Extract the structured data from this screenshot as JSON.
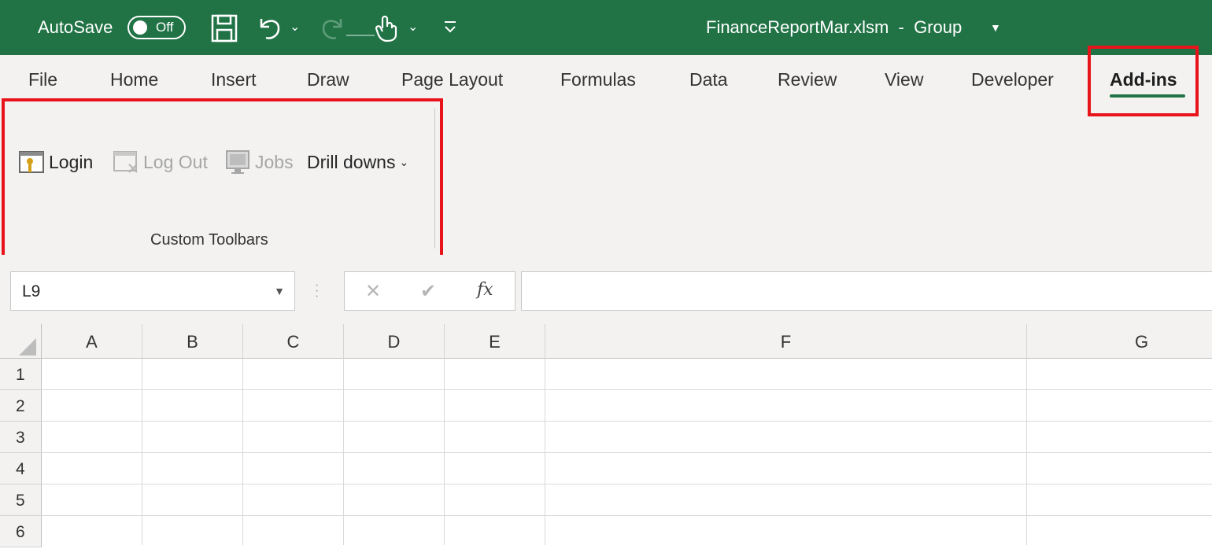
{
  "colors": {
    "titlebar": "#217346",
    "ribbon_bg": "#f3f2f1",
    "highlight": "#e8141b",
    "active_tab_underline": "#217346"
  },
  "titlebar": {
    "autosave_label": "AutoSave",
    "autosave_state": "Off",
    "document_title": "FinanceReportMar.xlsm  -  Group",
    "icons": [
      "save-icon",
      "undo-icon",
      "redo-icon",
      "touch-mode-icon",
      "customize-qat-icon"
    ]
  },
  "tabs": [
    {
      "label": "File"
    },
    {
      "label": "Home"
    },
    {
      "label": "Insert"
    },
    {
      "label": "Draw"
    },
    {
      "label": "Page Layout"
    },
    {
      "label": "Formulas"
    },
    {
      "label": "Data"
    },
    {
      "label": "Review"
    },
    {
      "label": "View"
    },
    {
      "label": "Developer"
    },
    {
      "label": "Add-ins",
      "active": true
    }
  ],
  "ribbon_group": {
    "label": "Custom Toolbars",
    "buttons": [
      {
        "label": "Login",
        "icon": "login-key-icon",
        "enabled": true
      },
      {
        "label": "Log Out",
        "icon": "logout-icon",
        "enabled": false
      },
      {
        "label": "Jobs",
        "icon": "jobs-monitor-icon",
        "enabled": false
      },
      {
        "label": "Drill downs",
        "icon": "chevron-down-icon",
        "enabled": true
      }
    ]
  },
  "formula_bar": {
    "name_box": "L9",
    "cancel_symbol": "✕",
    "enter_symbol": "✔",
    "fx_label": "fx",
    "formula_value": ""
  },
  "sheet": {
    "columns": [
      "A",
      "B",
      "C",
      "D",
      "E",
      "F",
      "G"
    ],
    "rows": [
      "1",
      "2",
      "3",
      "4",
      "5",
      "6"
    ]
  }
}
